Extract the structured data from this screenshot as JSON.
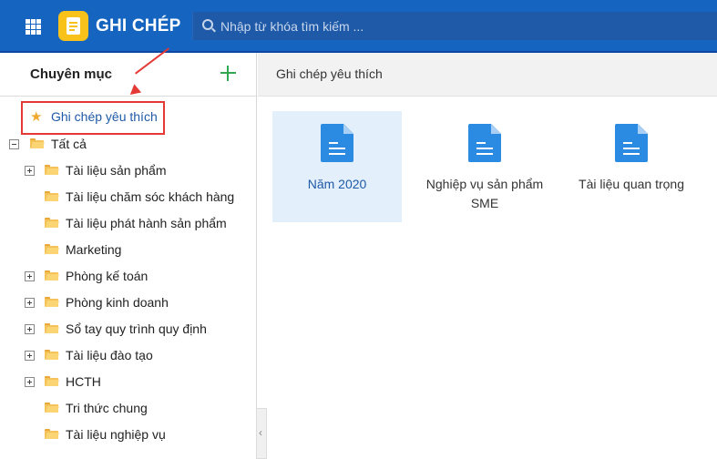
{
  "header": {
    "app_title": "GHI CHÉP",
    "search_placeholder": "Nhập từ khóa tìm kiếm ..."
  },
  "sidebar": {
    "title": "Chuyên mục",
    "favorite_label": "Ghi chép yêu thích",
    "root_label": "Tất cả",
    "items": [
      {
        "label": "Tài liệu sản phẩm",
        "expandable": true
      },
      {
        "label": "Tài liệu chăm sóc khách hàng",
        "expandable": false
      },
      {
        "label": "Tài liệu phát hành sản phẩm",
        "expandable": false
      },
      {
        "label": "Marketing",
        "expandable": false
      },
      {
        "label": "Phòng kế toán",
        "expandable": true
      },
      {
        "label": "Phòng kinh doanh",
        "expandable": true
      },
      {
        "label": "Sổ tay quy trình quy định",
        "expandable": true
      },
      {
        "label": "Tài liệu đào tạo",
        "expandable": true
      },
      {
        "label": "HCTH",
        "expandable": true
      },
      {
        "label": "Tri thức chung",
        "expandable": false
      },
      {
        "label": "Tài liệu nghiệp vụ",
        "expandable": false
      }
    ]
  },
  "main": {
    "title": "Ghi chép yêu thích",
    "notes": [
      {
        "label": "Năm 2020",
        "selected": true
      },
      {
        "label": "Nghiệp vụ sản phẩm SME",
        "selected": false
      },
      {
        "label": "Tài liệu quan trọng",
        "selected": false
      }
    ]
  },
  "colors": {
    "topbar": "#1565c0",
    "accent": "#2b8ae2",
    "highlight": "#e53935",
    "add": "#2fa84f",
    "folder": "#f5c259"
  }
}
